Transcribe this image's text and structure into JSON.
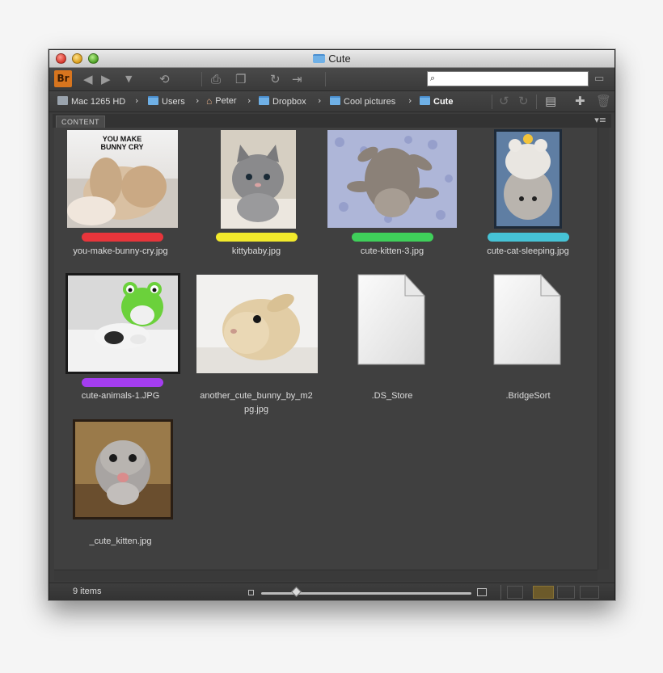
{
  "window": {
    "title": "Cute"
  },
  "toolbar": {
    "app_logo": "Br",
    "icons": [
      "back-arrow-icon",
      "forward-arrow-icon",
      "dropdown-arrow-icon",
      "boomerang-icon",
      "camera-icon",
      "copy-icon",
      "refresh-icon",
      "output-icon"
    ],
    "search_placeholder": "",
    "search_icon": "search-icon"
  },
  "pathbar": {
    "crumbs": [
      {
        "label": "Mac 1265 HD",
        "icon": "hard-drive-icon"
      },
      {
        "label": "Users",
        "icon": "folder-icon"
      },
      {
        "label": "Peter",
        "icon": "home-icon"
      },
      {
        "label": "Dropbox",
        "icon": "folder-icon"
      },
      {
        "label": "Cool pictures",
        "icon": "folder-icon"
      },
      {
        "label": "Cute",
        "icon": "folder-icon"
      }
    ],
    "separator": "›"
  },
  "panel": {
    "tab": "CONTENT",
    "menu_icon": "panel-menu-icon"
  },
  "files": [
    {
      "name": "you-make-bunny-cry.jpg",
      "name_lines": [
        "you-make-bunny-cry.jpg"
      ],
      "label_color": "#e8353b",
      "thumb_text": [
        "YOU MAKE",
        "BUNNY CRY"
      ]
    },
    {
      "name": "kittybaby.jpg",
      "name_lines": [
        "kittybaby.jpg"
      ],
      "label_color": "#f2ea2b"
    },
    {
      "name": "cute-kitten-3.jpg",
      "name_lines": [
        "cute-kitten-3.jpg"
      ],
      "label_color": "#3fd05a"
    },
    {
      "name": "cute-cat-sleeping.jpg",
      "name_lines": [
        "cute-cat-sleeping.jpg"
      ],
      "label_color": "#46c3d6"
    },
    {
      "name": "cute-animals-1.JPG",
      "name_lines": [
        "cute-animals-1.JPG"
      ],
      "label_color": "#a43df0"
    },
    {
      "name": "another_cute_bunny_by_m2pg.jpg",
      "name_lines": [
        "another_cute_bunny_by_m2",
        "pg.jpg"
      ],
      "label_color": ""
    },
    {
      "name": ".DS_Store",
      "name_lines": [
        ".DS_Store"
      ],
      "label_color": ""
    },
    {
      "name": ".BridgeSort",
      "name_lines": [
        ".BridgeSort"
      ],
      "label_color": ""
    },
    {
      "name": "_cute_kitten.jpg",
      "name_lines": [
        "_cute_kitten.jpg"
      ],
      "label_color": ""
    }
  ],
  "statusbar": {
    "item_count": "9 items"
  }
}
